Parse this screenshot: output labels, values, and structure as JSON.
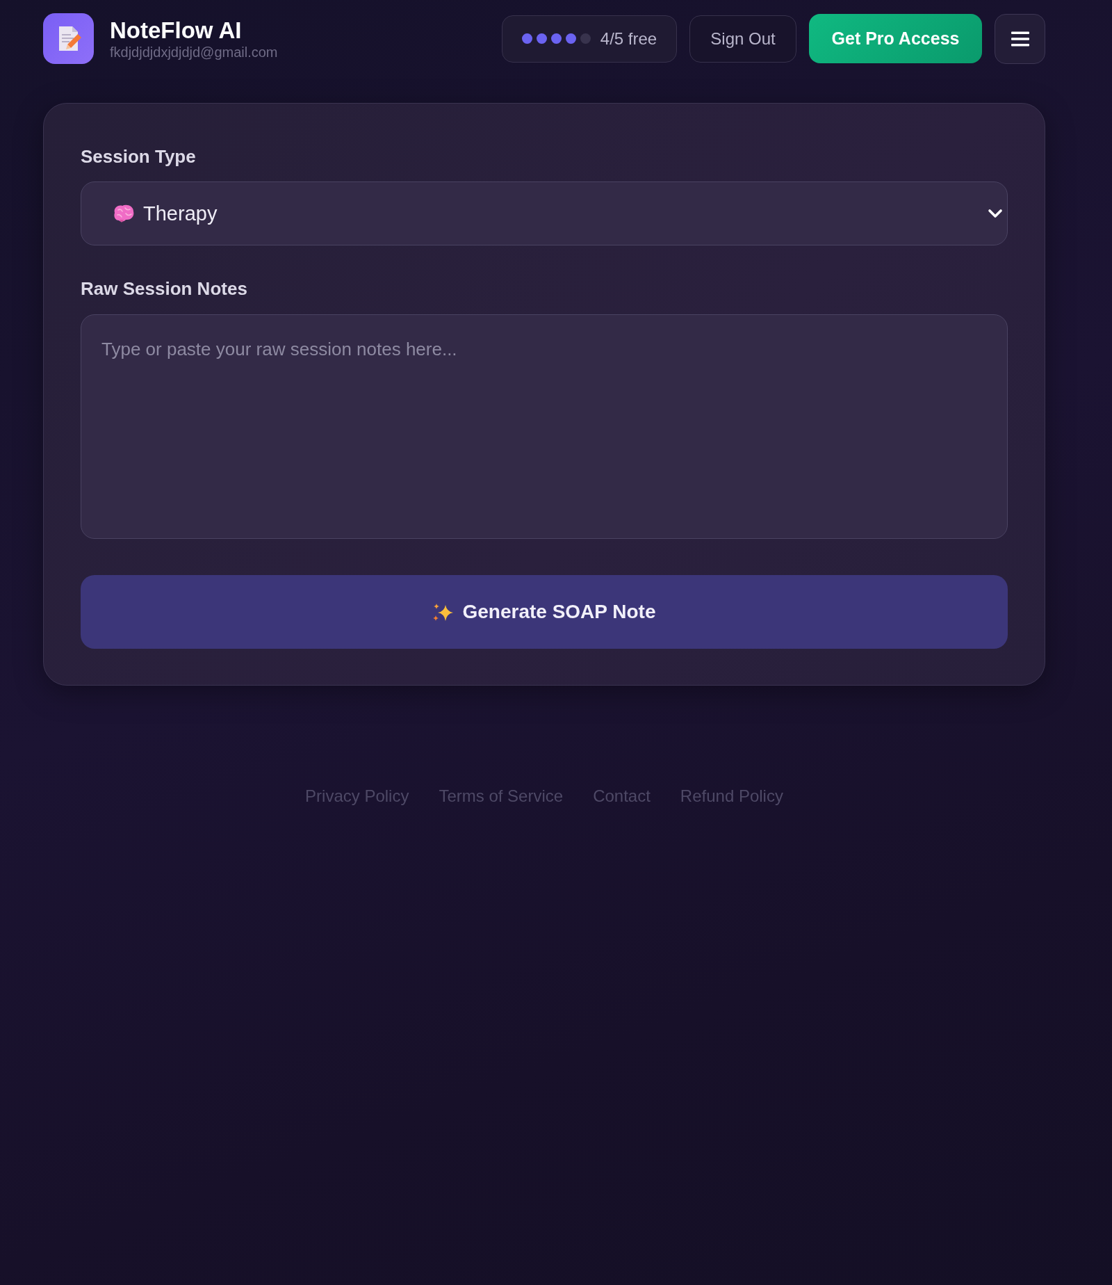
{
  "header": {
    "app_name": "NoteFlow AI",
    "email": "fkdjdjdjdxjdjdjd@gmail.com",
    "usage": {
      "dots": [
        {
          "filled": true
        },
        {
          "filled": true
        },
        {
          "filled": true
        },
        {
          "filled": true
        },
        {
          "filled": false
        }
      ],
      "label": "4/5 free"
    },
    "buttons": [
      {
        "kind": "outline",
        "label": "Sign Out"
      },
      {
        "kind": "primary",
        "label": "Get Pro Access"
      },
      {
        "kind": "menu"
      }
    ]
  },
  "form": {
    "session_type": {
      "label": "Session Type",
      "value": "Therapy"
    },
    "notes": {
      "label": "Raw Session Notes",
      "placeholder": "Type or paste your raw session notes here..."
    },
    "submit": {
      "label": "Generate SOAP Note"
    }
  },
  "footer": {
    "links": [
      "Privacy Policy",
      "Terms of Service",
      "Contact",
      "Refund Policy"
    ]
  }
}
